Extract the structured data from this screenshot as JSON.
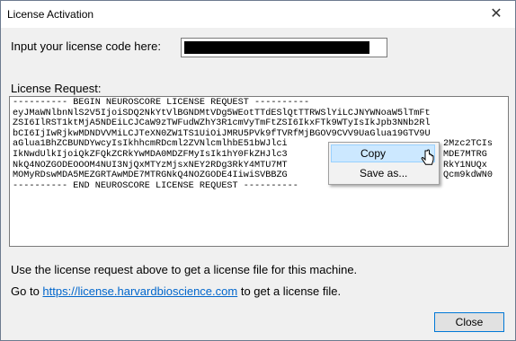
{
  "window": {
    "title": "License Activation",
    "close_glyph": "✕"
  },
  "license_code": {
    "label": "Input your license code here:",
    "value_redacted": true
  },
  "license_request": {
    "label": "License Request:",
    "lines": [
      "---------- BEGIN NEUROSCORE LICENSE REQUEST ----------",
      "eyJMaWNlbnNlS2V5IjoiSDQ2NkYtVlBGNDMtVDg5WEotTTdESlQtTTRWSlYiLCJNYWNoaW5lTmFt",
      "ZSI6IlRST1ktMjA5NDEiLCJCaW9zTWFudWZhY3R1cmVyTmFtZSI6IkxFTk9WTyIsIkJpb3NNb2Rl",
      "bCI6IjIwRjkwMDNDVVMiLCJTeXN0ZW1TS1UiOiJMRU5PVk9fTVRfMjBGOV9CVV9UaGlua19GTV9U",
      "aGlua1BhZCBUNDYwcyIsIkhhcmRDcml2ZVNlcmlhbE51bWJlci",
      "IkNwdUlkIjoiQkZFQkZCRkYwMDA0MDZFMyIsIk1hY0FkZHJlc3",
      "NkQ4NOZGODEOOOM4NUI3NjQxMTYzMjsxNEY2RDg3RkY4MTU7MT",
      "MOMyRDswMDA5MEZGRTAwMDE7MTRGNkQ4NOZGODE4IiwiSVBBZG",
      "---------- END NEUROSCORE LICENSE REQUEST ----------"
    ],
    "line_tails": [
      "",
      "",
      "",
      "",
      "2Mzc2TCIs",
      "MDE7MTRG",
      "RkY1NUQx",
      "Qcm9kdWN0",
      ""
    ]
  },
  "context_menu": {
    "items": [
      {
        "label": "Copy",
        "highlighted": true
      },
      {
        "label": "Save as...",
        "highlighted": false
      }
    ]
  },
  "info": {
    "line1": "Use the license request above to get a license file for this machine.",
    "go_to": "Go to",
    "link": "https://license.harvardbioscience.com",
    "suffix": "to get a license file."
  },
  "buttons": {
    "close": "Close"
  },
  "colors": {
    "accent": "#0078d7",
    "link": "#0066cc",
    "menu_highlight": "#cce8ff"
  }
}
